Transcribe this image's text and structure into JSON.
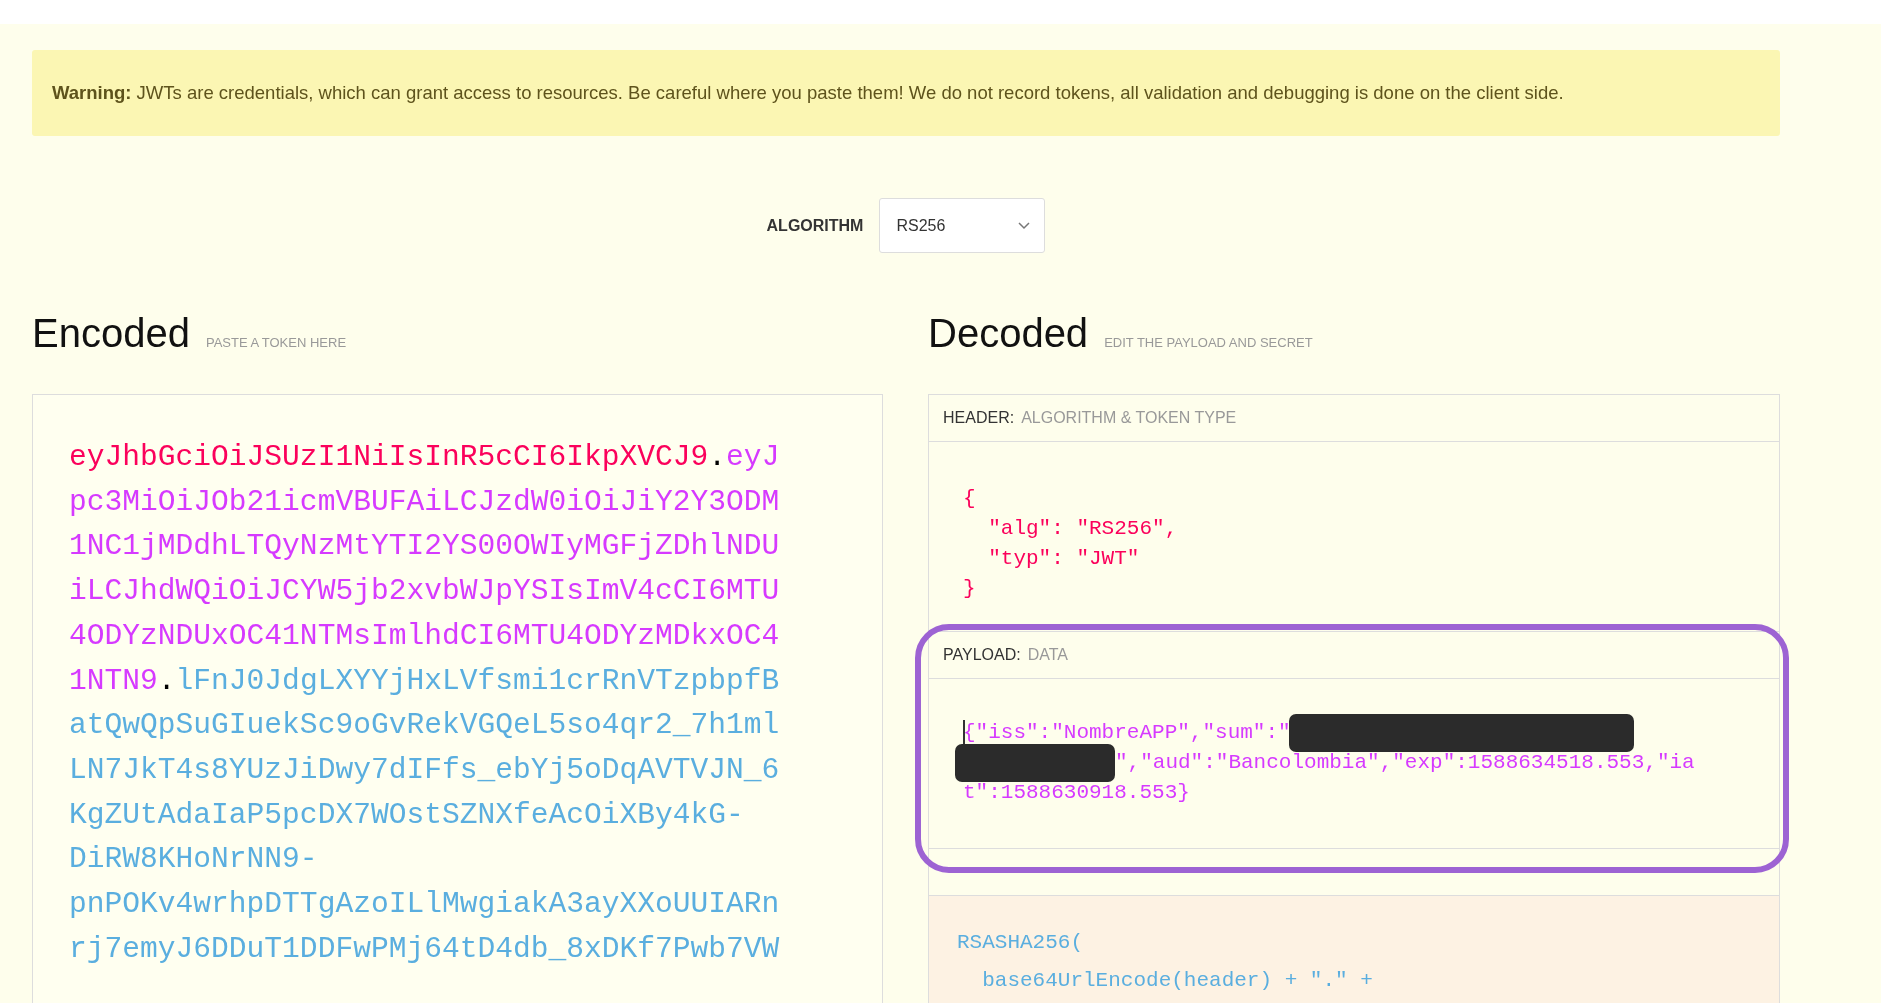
{
  "warning": "**Warning:** JWTs are credentials, which can grant access to resources. Be careful where you paste them! We do not record tokens, all validation and debugging is done on the client side.",
  "algorithm": {
    "label": "ALGORITHM",
    "value": "RS256"
  },
  "encoded": {
    "title": "Encoded",
    "subtitle": "PASTE A TOKEN HERE",
    "lines": [
      [
        {
          "kind": "header",
          "text": "eyJhbGciOiJSUzI1NiIsInR5cCI6IkpXVCJ9"
        },
        {
          "kind": "dot",
          "text": "."
        },
        {
          "kind": "payload",
          "text": "eyJ"
        }
      ],
      [
        {
          "kind": "payload",
          "text": "pc3MiOiJOb21icmVBUFAiLCJzdW0iOiJiY2Y3ODM"
        }
      ],
      [
        {
          "kind": "payload",
          "text": "1NC1jMDdhLTQyNzMtYTI2YS00OWIyMGFjZDhlNDU"
        }
      ],
      [
        {
          "kind": "payload",
          "text": "iLCJhdWQiOiJCYW5jb2xvbWJpYSIsImV4cCI6MTU"
        }
      ],
      [
        {
          "kind": "payload",
          "text": "4ODYzNDUxOC41NTMsImlhdCI6MTU4ODYzMDkxOC4"
        }
      ],
      [
        {
          "kind": "payload",
          "text": "1NTN9"
        },
        {
          "kind": "dot",
          "text": "."
        },
        {
          "kind": "signature",
          "text": "lFnJ0JdgLXYYjHxLVfsmi1crRnVTzpbpfB"
        }
      ],
      [
        {
          "kind": "signature",
          "text": "atQwQpSuGIuekSc9oGvRekVGQeL5so4qr2_7h1ml"
        }
      ],
      [
        {
          "kind": "signature",
          "text": "LN7JkT4s8YUzJiDwy7dIFfs_ebYj5oDqAVTVJN_6"
        }
      ],
      [
        {
          "kind": "signature",
          "text": "KgZUtAdaIaP5pcDX7WOstSZNXfeAcOiXBy4kG-"
        }
      ],
      [
        {
          "kind": "signature",
          "text": "DiRW8KHoNrNN9-"
        }
      ],
      [
        {
          "kind": "signature",
          "text": "pnPOKv4wrhpDTTgAzoILlMwgiakA3ayXXoUUIARn"
        }
      ],
      [
        {
          "kind": "signature",
          "text": "rj7emyJ6DDuT1DDFwPMj64tD4db_8xDKf7Pwb7VW"
        }
      ]
    ]
  },
  "decoded": {
    "title": "Decoded",
    "subtitle": "EDIT THE PAYLOAD AND SECRET",
    "header": {
      "label": "HEADER:",
      "sublabel": "ALGORITHM & TOKEN TYPE",
      "lines": [
        "{",
        "  \"alg\": \"RS256\",",
        "  \"typ\": \"JWT\"",
        "}"
      ]
    },
    "payload": {
      "label": "PAYLOAD:",
      "sublabel": "DATA",
      "lines": [
        [
          {
            "kind": "text",
            "text": "{\"iss\":\"NombreAPP\",\"sum\":\""
          },
          {
            "kind": "redacted"
          }
        ],
        [
          {
            "kind": "redacted"
          },
          {
            "kind": "text",
            "text": "\",\"aud\":\"Bancolombia\",\"exp\":1588634518.553,\"ia"
          }
        ],
        [
          {
            "kind": "text",
            "text": "t\":1588630918.553}"
          }
        ]
      ]
    },
    "signature": {
      "lines": [
        "RSASHA256(",
        "  base64UrlEncode(header) + \".\" +"
      ]
    }
  }
}
